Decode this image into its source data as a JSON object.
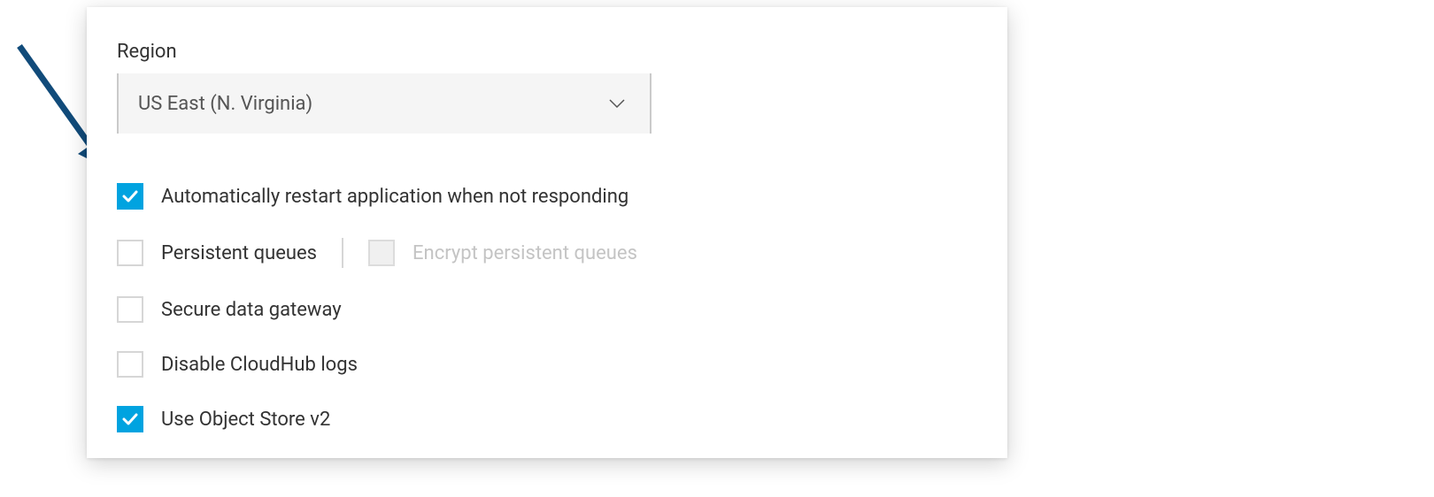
{
  "colors": {
    "accent": "#00a3e0",
    "arrow": "#114b7a"
  },
  "region": {
    "label": "Region",
    "selected": "US East (N. Virginia)"
  },
  "options": {
    "auto_restart": {
      "label": "Automatically restart application when not responding",
      "checked": true
    },
    "persistent_queues": {
      "label": "Persistent queues",
      "checked": false
    },
    "encrypt_persistent_queues": {
      "label": "Encrypt persistent queues",
      "checked": false,
      "disabled": true
    },
    "secure_data_gateway": {
      "label": "Secure data gateway",
      "checked": false
    },
    "disable_cloudhub_logs": {
      "label": "Disable CloudHub logs",
      "checked": false
    },
    "use_object_store_v2": {
      "label": "Use Object Store v2",
      "checked": true
    }
  }
}
